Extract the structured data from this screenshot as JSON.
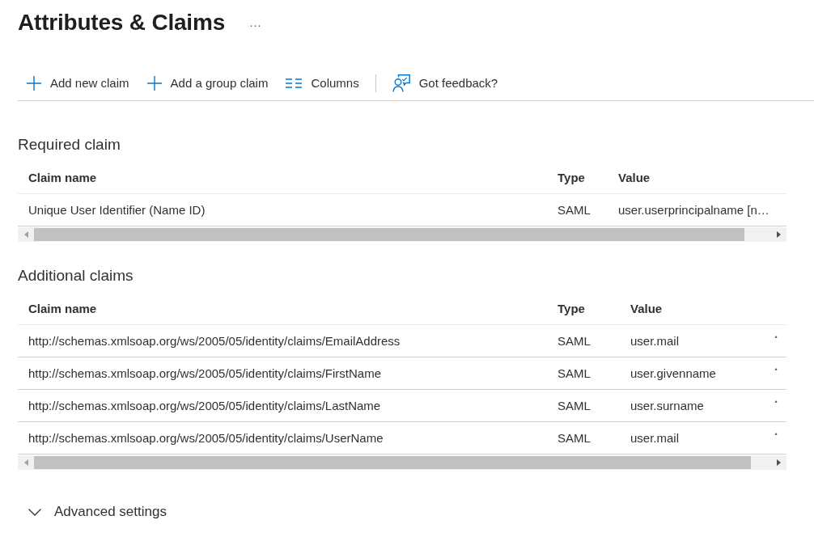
{
  "page": {
    "title": "Attributes & Claims",
    "more": "···"
  },
  "toolbar": {
    "groups": [
      [
        {
          "kind": "add",
          "label": "Add new claim"
        },
        {
          "kind": "add",
          "label": "Add a group claim"
        },
        {
          "kind": "columns",
          "label": "Columns"
        }
      ],
      [
        {
          "kind": "feedback",
          "label": "Got feedback?"
        }
      ]
    ]
  },
  "sections": [
    {
      "heading": "Required claim",
      "columns": [
        "Claim name",
        "Type",
        "Value"
      ],
      "rows": [
        {
          "claim_name": "Unique User Identifier (Name ID)",
          "type": "SAML",
          "value": "user.userprincipalname [n…"
        }
      ]
    },
    {
      "heading": "Additional claims",
      "columns": [
        "Claim name",
        "Type",
        "Value"
      ],
      "rows": [
        {
          "claim_name": "http://schemas.xmlsoap.org/ws/2005/05/identity/claims/EmailAddress",
          "type": "SAML",
          "value": "user.mail",
          "column_4": "•"
        },
        {
          "claim_name": "http://schemas.xmlsoap.org/ws/2005/05/identity/claims/FirstName",
          "type": "SAML",
          "value": "user.givenname",
          "column_4": "•"
        },
        {
          "claim_name": "http://schemas.xmlsoap.org/ws/2005/05/identity/claims/LastName",
          "type": "SAML",
          "value": "user.surname",
          "column_4": "•"
        },
        {
          "claim_name": "http://schemas.xmlsoap.org/ws/2005/05/identity/claims/UserName",
          "type": "SAML",
          "value": "user.mail",
          "column_4": "•"
        }
      ]
    }
  ],
  "advanced": {
    "label": "Advanced settings",
    "expanded": false
  }
}
